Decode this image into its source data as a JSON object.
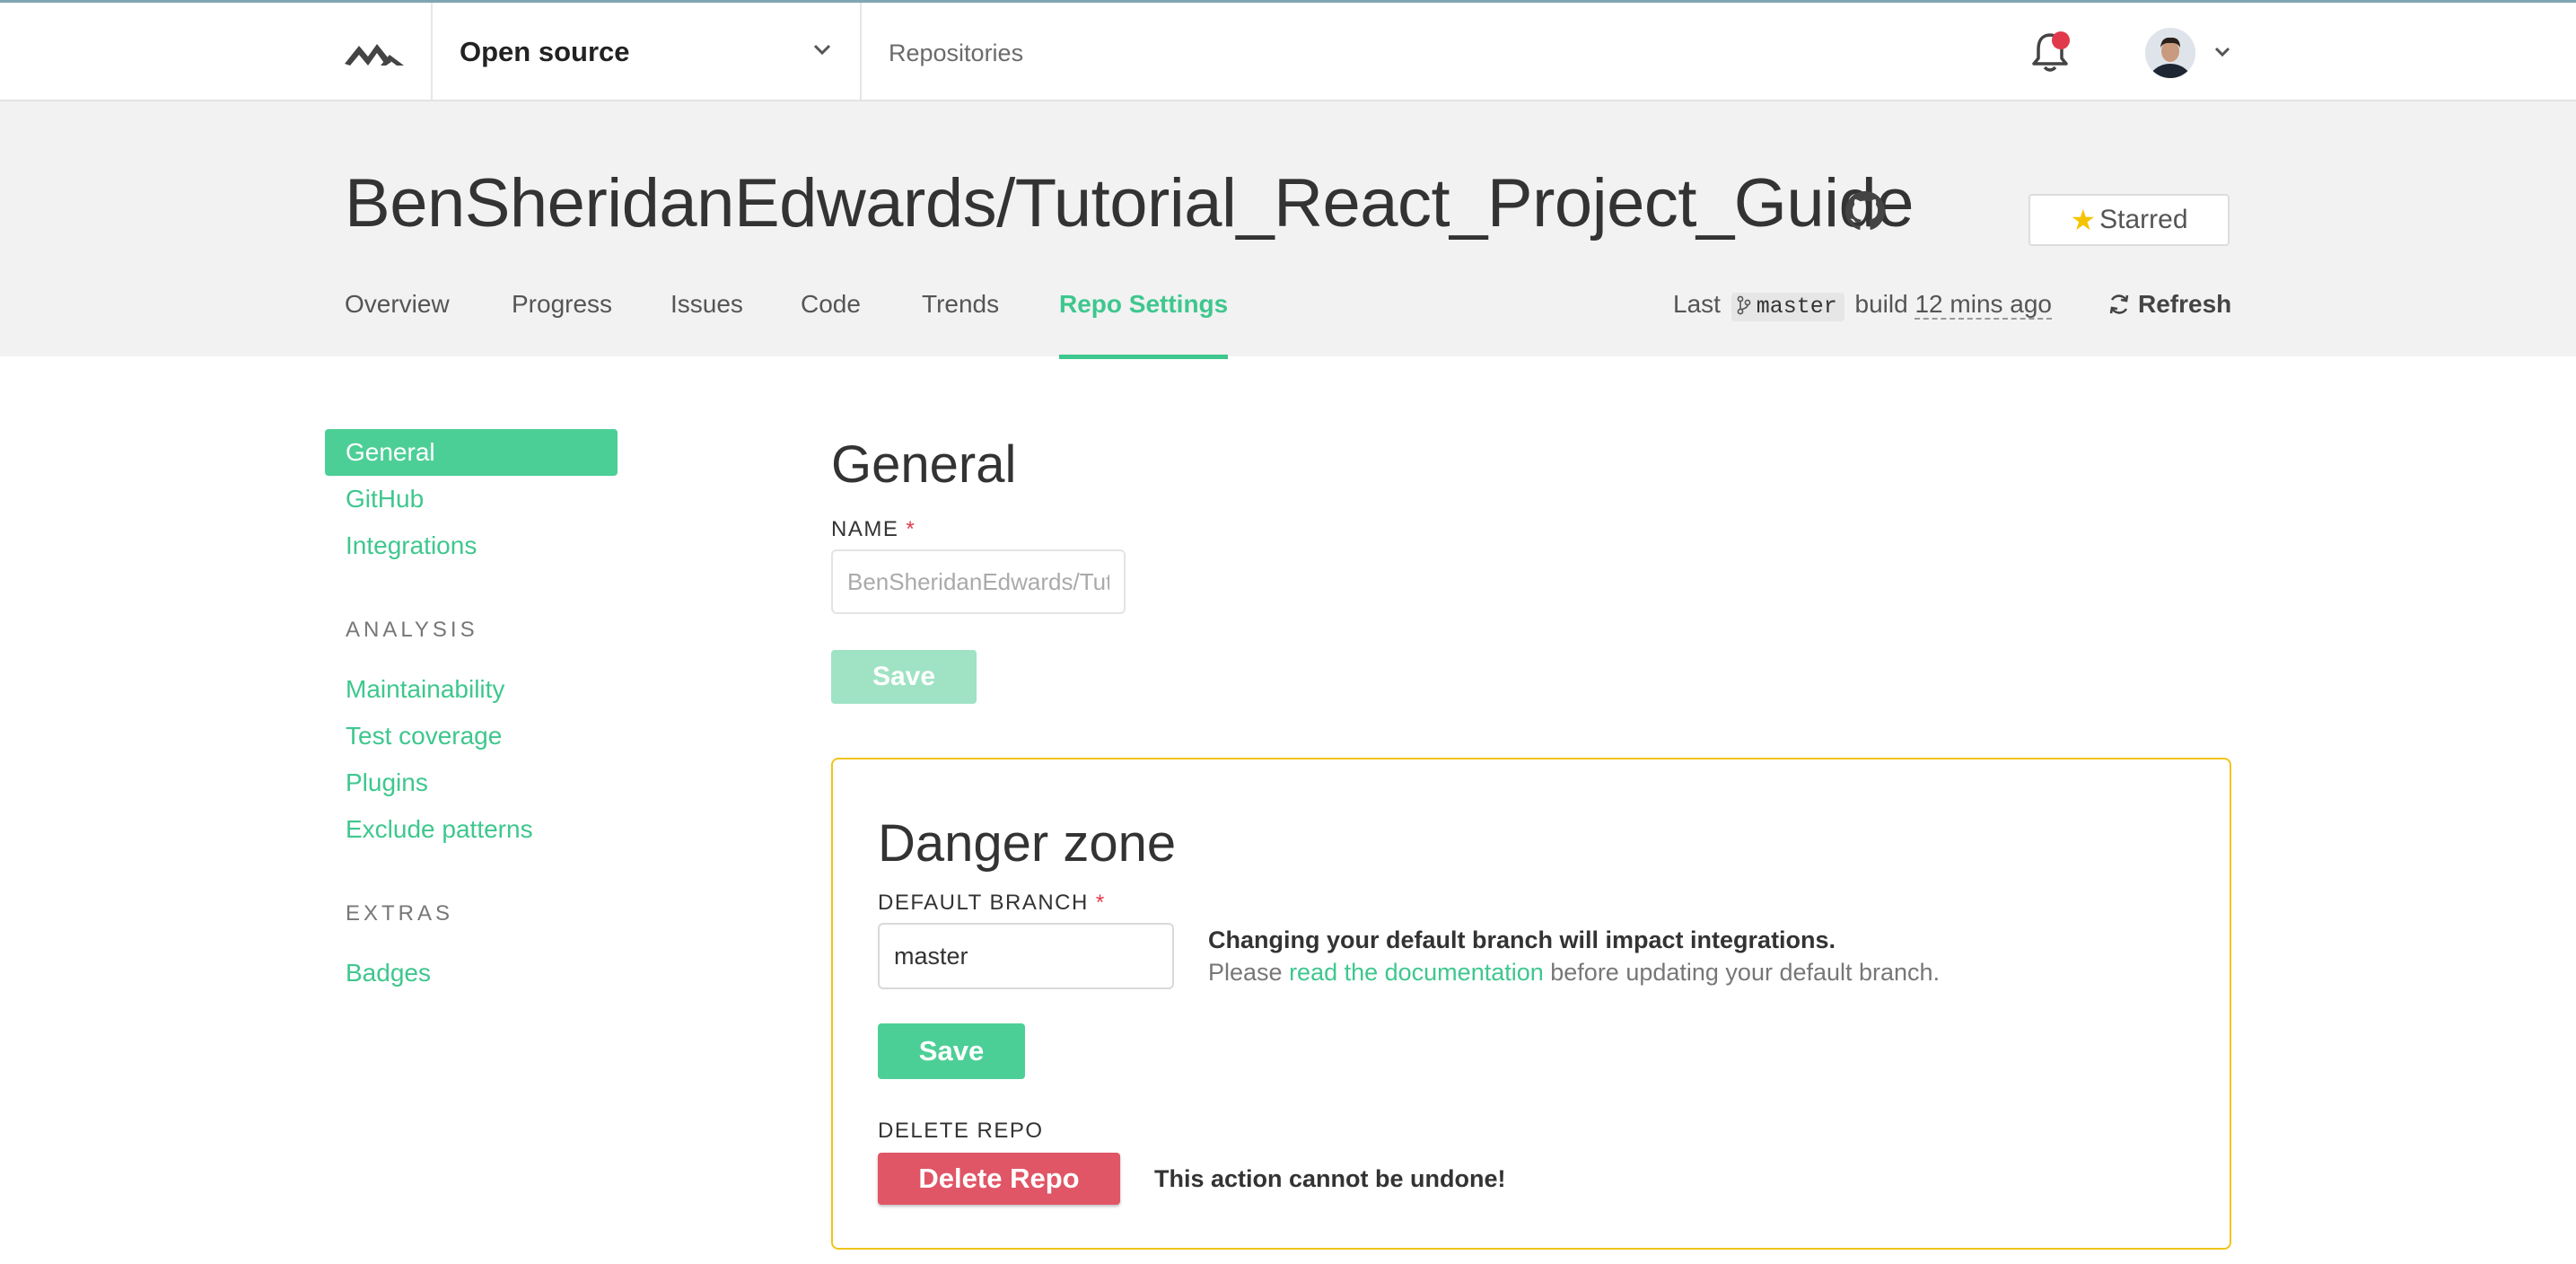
{
  "navbar": {
    "org_name": "Open source",
    "repositories_link": "Repositories"
  },
  "repo": {
    "title": "BenSheridanEdwards/Tutorial_React_Project_Guide",
    "star_label": "Starred"
  },
  "tabs": [
    {
      "label": "Overview"
    },
    {
      "label": "Progress"
    },
    {
      "label": "Issues"
    },
    {
      "label": "Code"
    },
    {
      "label": "Trends"
    },
    {
      "label": "Repo Settings",
      "active": true
    }
  ],
  "build": {
    "prefix": "Last",
    "branch": "master",
    "middle": "build",
    "time_ago": "12 mins ago"
  },
  "refresh_label": "Refresh",
  "sidebar": {
    "items": [
      {
        "label": "General",
        "active": true
      },
      {
        "label": "GitHub"
      },
      {
        "label": "Integrations"
      }
    ],
    "analysis_heading": "ANALYSIS",
    "analysis_items": [
      {
        "label": "Maintainability"
      },
      {
        "label": "Test coverage"
      },
      {
        "label": "Plugins"
      },
      {
        "label": "Exclude patterns"
      }
    ],
    "extras_heading": "EXTRAS",
    "extras_items": [
      {
        "label": "Badges"
      }
    ]
  },
  "general": {
    "title": "General",
    "name_label": "NAME",
    "required_mark": "*",
    "name_value": "BenSheridanEdwards/Tutorial_React_Project_Guide",
    "save_label": "Save"
  },
  "danger": {
    "title": "Danger zone",
    "branch_label": "DEFAULT BRANCH",
    "branch_value": "master",
    "warning_strong": "Changing your default branch will impact integrations.",
    "warning_pre": "Please ",
    "warning_link": "read the documentation",
    "warning_post": " before updating your default branch.",
    "save_label": "Save",
    "delete_label": "DELETE REPO",
    "delete_button": "Delete Repo",
    "undone_text": "This action cannot be undone!"
  },
  "colors": {
    "accent": "#4ccf96",
    "accent_text": "#3ec78e",
    "danger_border": "#f0c419",
    "delete": "#e05666",
    "notification": "#e0394b"
  },
  "icons": [
    "logo-icon",
    "chevron-down-icon",
    "bell-icon",
    "github-icon",
    "star-icon",
    "git-branch-icon",
    "refresh-icon"
  ]
}
